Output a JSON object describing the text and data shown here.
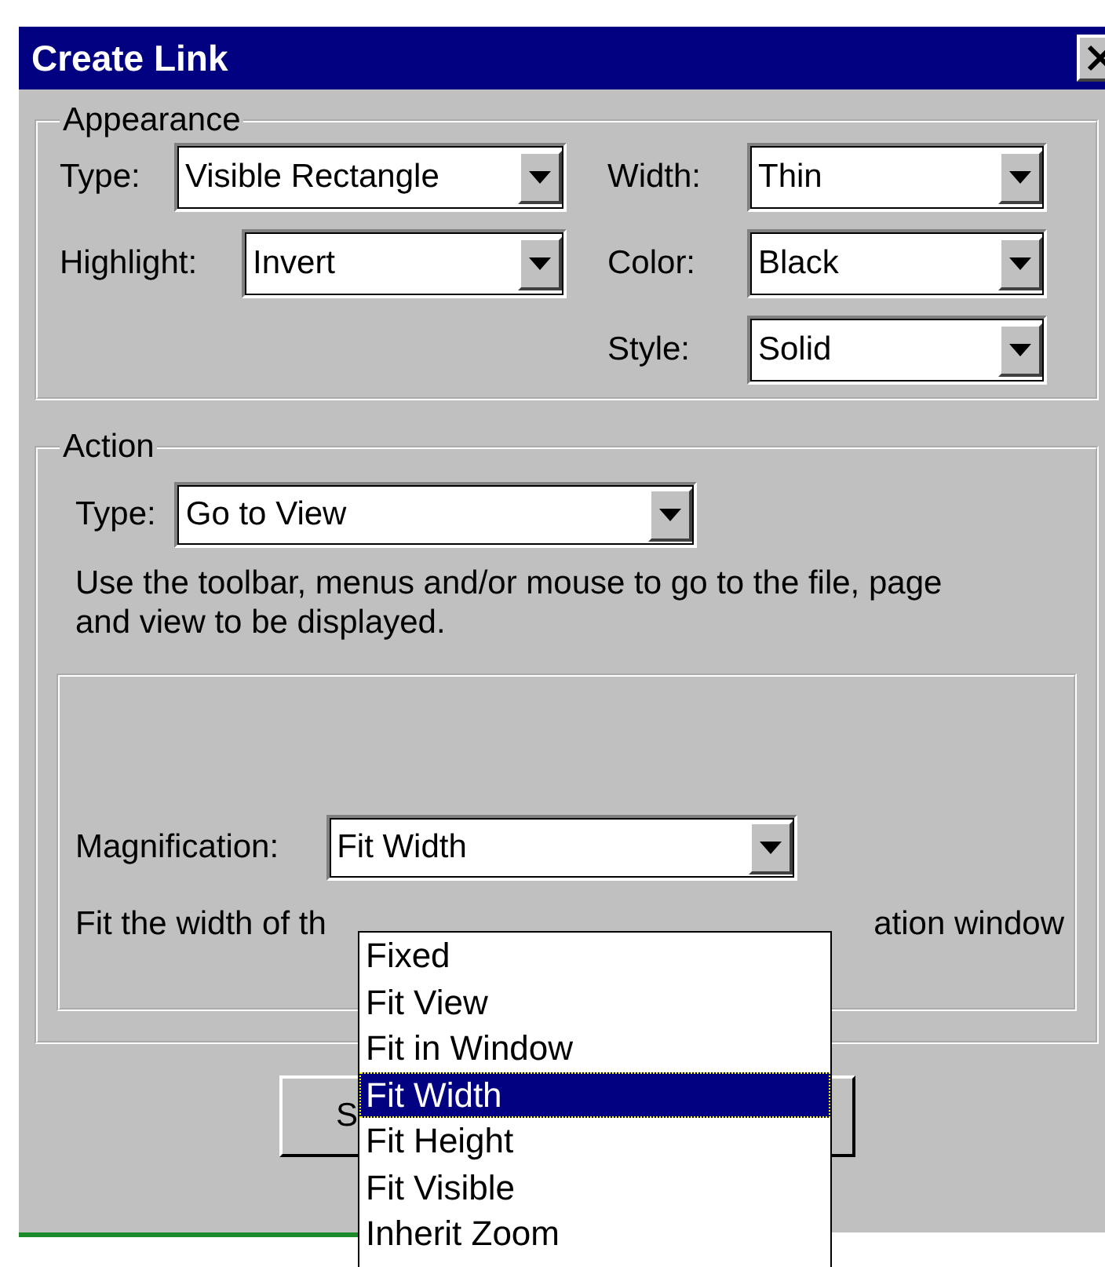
{
  "window": {
    "title": "Create Link"
  },
  "appearance": {
    "legend": "Appearance",
    "left": [
      {
        "label": "Type:",
        "value": "Visible Rectangle"
      },
      {
        "label": "Highlight:",
        "value": "Invert"
      }
    ],
    "right": [
      {
        "label": "Width:",
        "value": "Thin"
      },
      {
        "label": "Color:",
        "value": "Black"
      },
      {
        "label": "Style:",
        "value": "Solid"
      }
    ]
  },
  "action": {
    "legend": "Action",
    "type": {
      "label": "Type:",
      "value": "Go to View"
    },
    "help": "Use the toolbar, menus and/or mouse to go to the file, page and view to be displayed.",
    "magnification": {
      "label": "Magnification:",
      "value": "Fit Width"
    },
    "description_start": "Fit the width of th",
    "description_end": "ation window"
  },
  "dropdown_list": [
    {
      "label": "Fixed",
      "selected": false
    },
    {
      "label": "Fit View",
      "selected": false
    },
    {
      "label": "Fit in Window",
      "selected": false
    },
    {
      "label": "Fit Width",
      "selected": true
    },
    {
      "label": "Fit Height",
      "selected": false
    },
    {
      "label": "Fit Visible",
      "selected": false
    },
    {
      "label": "Inherit Zoom",
      "selected": false
    }
  ],
  "buttons": [
    {
      "kind": "text",
      "label": "S"
    },
    {
      "kind": "blank"
    }
  ]
}
